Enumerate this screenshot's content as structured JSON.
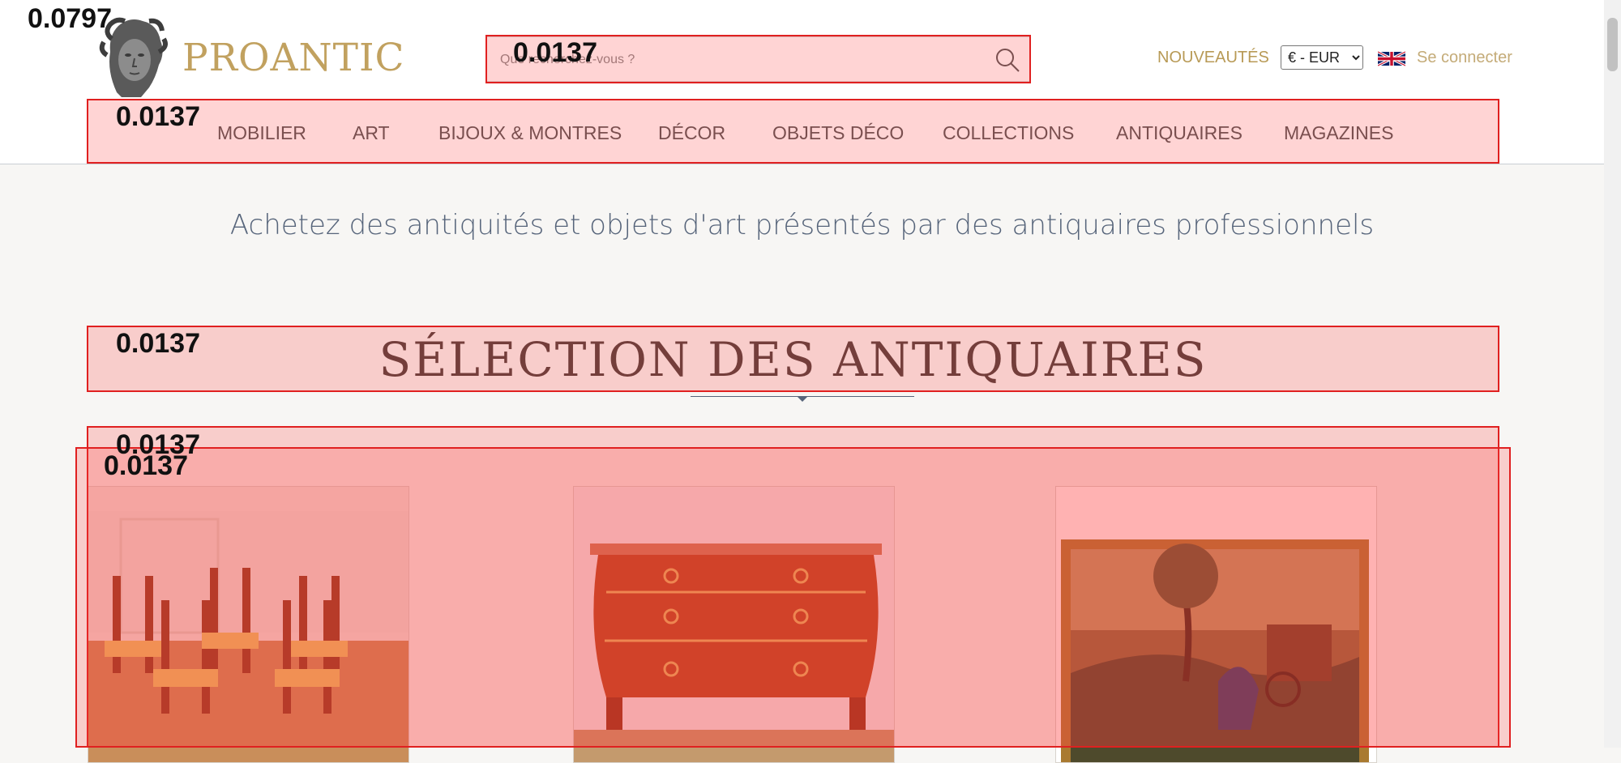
{
  "brand": {
    "name": "PROANTIC"
  },
  "search": {
    "placeholder": "Que recherchez-vous ?"
  },
  "header": {
    "nouveautes": "NOUVEAUTÉS",
    "currency": {
      "selected": "€ - EUR",
      "options": [
        "€ - EUR"
      ]
    },
    "language_flag": "uk-flag-icon",
    "login": "Se connecter"
  },
  "nav": {
    "items": [
      {
        "label": "MOBILIER"
      },
      {
        "label": "ART"
      },
      {
        "label": "BIJOUX & MONTRES"
      },
      {
        "label": "DÉCOR"
      },
      {
        "label": "OBJETS DÉCO"
      },
      {
        "label": "COLLECTIONS"
      },
      {
        "label": "ANTIQUAIRES"
      },
      {
        "label": "MAGAZINES"
      }
    ]
  },
  "main": {
    "tagline": "Achetez des antiquités et objets d'art présentés par des antiquaires professionnels",
    "section_title": "SÉLECTION DES ANTIQUAIRES",
    "products": [
      {
        "image": "set-of-chairs-photo"
      },
      {
        "image": "commode-photo"
      },
      {
        "image": "painting-photo"
      }
    ]
  },
  "overlays": [
    {
      "name": "logo",
      "score": "0.0797"
    },
    {
      "name": "search",
      "score": "0.0137"
    },
    {
      "name": "nav",
      "score": "0.0137"
    },
    {
      "name": "section-title",
      "score": "0.0137"
    },
    {
      "name": "products-top",
      "score": "0.0137"
    },
    {
      "name": "products-row",
      "score": "0.0137"
    }
  ],
  "colors": {
    "brand_gold": "#c1a15f",
    "overlay_red": "#e02020",
    "tagline_blue": "#56647a",
    "title_brown": "#4e3f3b"
  }
}
